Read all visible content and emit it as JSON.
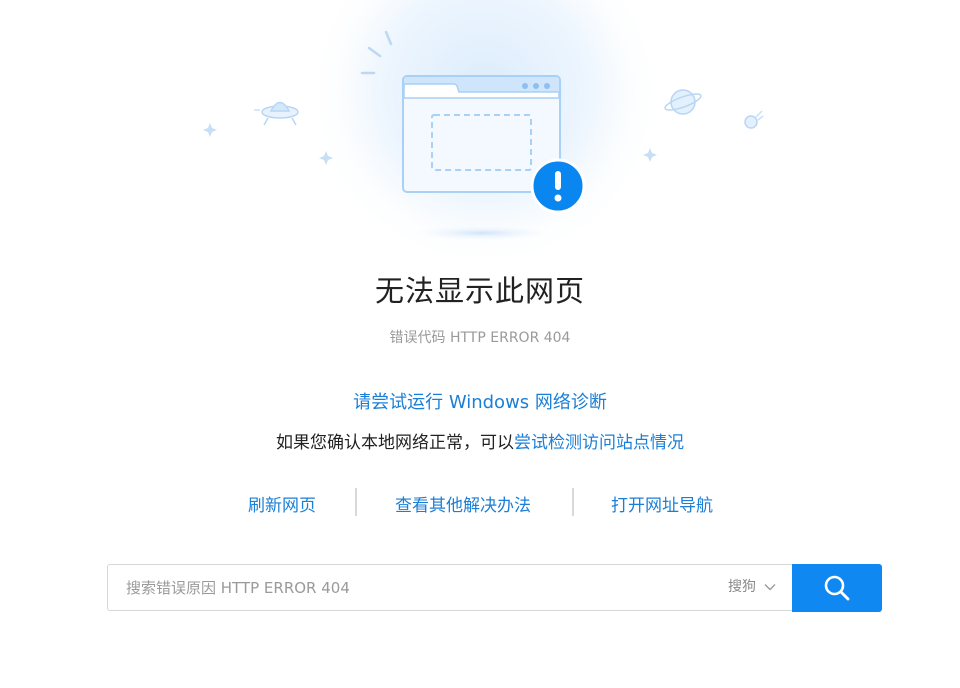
{
  "error": {
    "title": "无法显示此网页",
    "code": "错误代码 HTTP ERROR 404"
  },
  "help": {
    "diagnose_link": "请尝试运行 Windows 网络诊断",
    "check_prefix": "如果您确认本地网络正常，可以",
    "check_link": "尝试检测访问站点情况"
  },
  "actions": [
    {
      "label": "刷新网页"
    },
    {
      "label": "查看其他解决办法"
    },
    {
      "label": "打开网址导航"
    }
  ],
  "search": {
    "placeholder": "搜索错误原因 HTTP ERROR 404",
    "value": "",
    "engine": "搜狗"
  },
  "colors": {
    "accent": "#1088f2",
    "link": "#1b7fd6",
    "alert": "#0a86f0"
  },
  "icons": {
    "hero": "browser-window-error-illustration",
    "alert": "exclamation-icon",
    "search": "magnifier-icon",
    "dropdown": "chevron-down-icon"
  }
}
